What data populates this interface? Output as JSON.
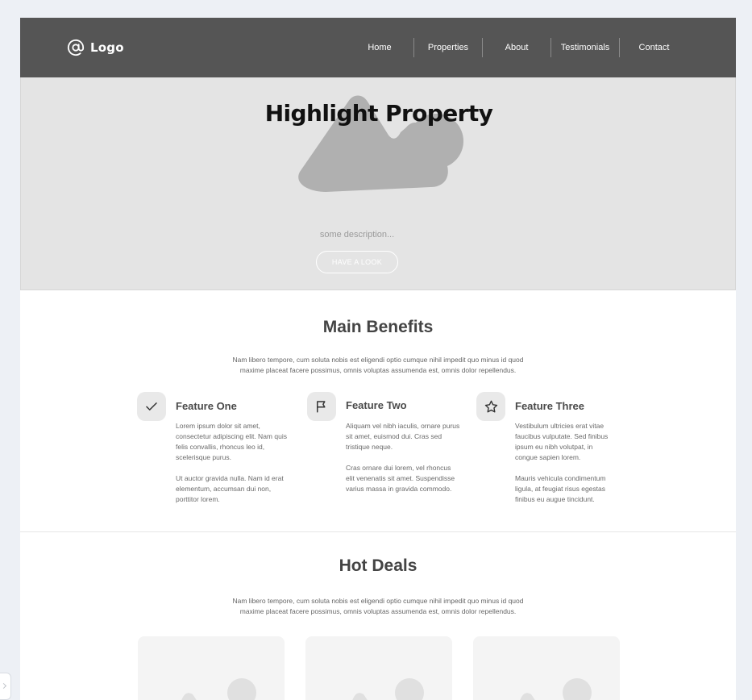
{
  "header": {
    "logo_text": "Logo",
    "logo_icon": "at-sign-icon",
    "nav": [
      "Home",
      "Properties",
      "About",
      "Testimonials",
      "Contact"
    ]
  },
  "hero": {
    "title": "Highlight Property",
    "description": "some description...",
    "button_label": "HAVE A LOOK",
    "image_icon": "image-placeholder-icon"
  },
  "benefits": {
    "title": "Main Benefits",
    "subtitle": "Nam libero tempore, cum soluta nobis est eligendi optio cumque nihil impedit quo minus id quod maxime placeat facere possimus, omnis voluptas assumenda est, omnis dolor repellendus.",
    "features": [
      {
        "icon": "check-icon",
        "title": "Feature One",
        "p1": "Lorem ipsum dolor sit amet, consectetur adipiscing elit. Nam quis felis convallis, rhoncus leo id, scelerisque purus.",
        "p2": "Ut auctor gravida nulla. Nam id erat elementum, accumsan dui non, porttitor lorem."
      },
      {
        "icon": "flag-icon",
        "title": "Feature Two",
        "p1": "Aliquam vel nibh iaculis, ornare purus sit amet, euismod dui. Cras sed tristique neque.",
        "p2": "Cras ornare dui lorem, vel rhoncus elit venenatis sit amet. Suspendisse varius massa in gravida commodo."
      },
      {
        "icon": "star-icon",
        "title": "Feature Three",
        "p1": "Vestibulum ultricies erat vitae faucibus vulputate. Sed finibus ipsum eu nibh volutpat, in congue sapien lorem.",
        "p2": "Mauris vehicula condimentum ligula, at feugiat risus egestas finibus eu augue tincidunt."
      }
    ]
  },
  "deals": {
    "title": "Hot Deals",
    "subtitle": "Nam libero tempore, cum soluta nobis est eligendi optio cumque nihil impedit quo minus id quod maxime placeat facere possimus, omnis voluptas assumenda est, omnis dolor repellendus.",
    "card_icon": "image-placeholder-icon"
  },
  "colors": {
    "header_bg": "#555555",
    "hero_bg": "#e4e4e4",
    "placeholder": "#b0b0b0",
    "page_bg": "#edf0f5"
  }
}
